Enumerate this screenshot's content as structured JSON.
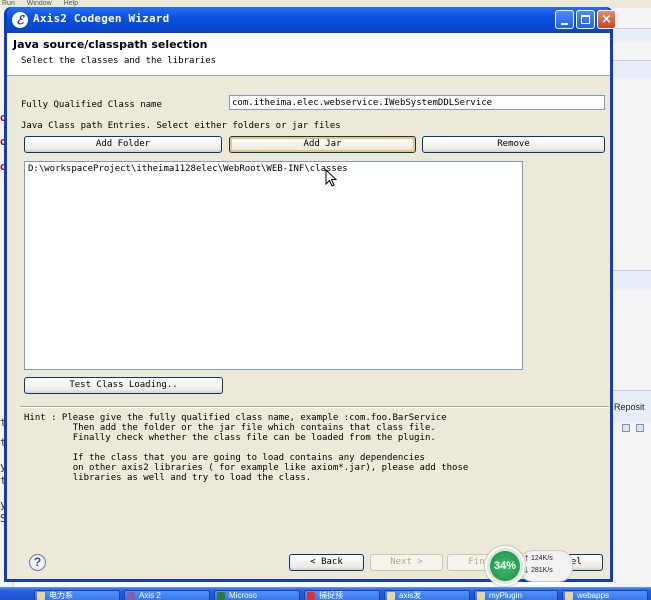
{
  "background": {
    "menu": [
      "Run",
      "Window",
      "Help"
    ],
    "left_glyphs": [
      "oo",
      "oo",
      "oo",
      "t",
      "t",
      "y",
      "t",
      "y",
      "Se"
    ],
    "right_panel_label": "Reposit"
  },
  "window": {
    "title": "Axis2 Codegen Wizard",
    "min_label": "Minimize",
    "max_label": "Maximize",
    "close_label": "×"
  },
  "header": {
    "title": "Java source/classpath selection",
    "subtitle": "Select the classes and the libraries"
  },
  "form": {
    "class_name_label": "Fully Qualified Class name",
    "class_name_value": "com.itheima.elec.webservice.IWebSystemDDLService",
    "classpath_label": "Java Class path Entries. Select either folders or jar files",
    "add_folder": "Add Folder",
    "add_jar": "Add Jar",
    "remove": "Remove",
    "entries": [
      "D:\\workspaceProject\\itheima1128elec\\WebRoot\\WEB-INF\\classes"
    ],
    "test_class_loading": "Test Class Loading.."
  },
  "hint": "Hint : Please give the fully qualified class name, example :com.foo.BarService\n         Then add the folder or the jar file which contains that class file.\n         Finally check whether the class file can be loaded from the plugin.\n\n         If the class that you are going to load contains any dependencies\n         on other axis2 libraries ( for example like axiom*.jar), please add those\n         libraries as well and try to load the class.",
  "footer": {
    "help": "?",
    "back": "< Back",
    "next": "Next >",
    "finish": "Finish",
    "cancel": "Cancel"
  },
  "network_widget": {
    "percent": "34%",
    "upload": "124K/s",
    "download": "281K/s"
  },
  "taskbar": {
    "items": [
      "电力系",
      "Axis 2",
      "Microso",
      "捕捉预",
      "axis发",
      "myPlugin",
      "webapps"
    ]
  },
  "colors": {
    "titlebar": "#0a52e2",
    "dialog_face": "#ece9d8",
    "taskbar": "#245edb",
    "widget_green": "#1d8c45"
  }
}
